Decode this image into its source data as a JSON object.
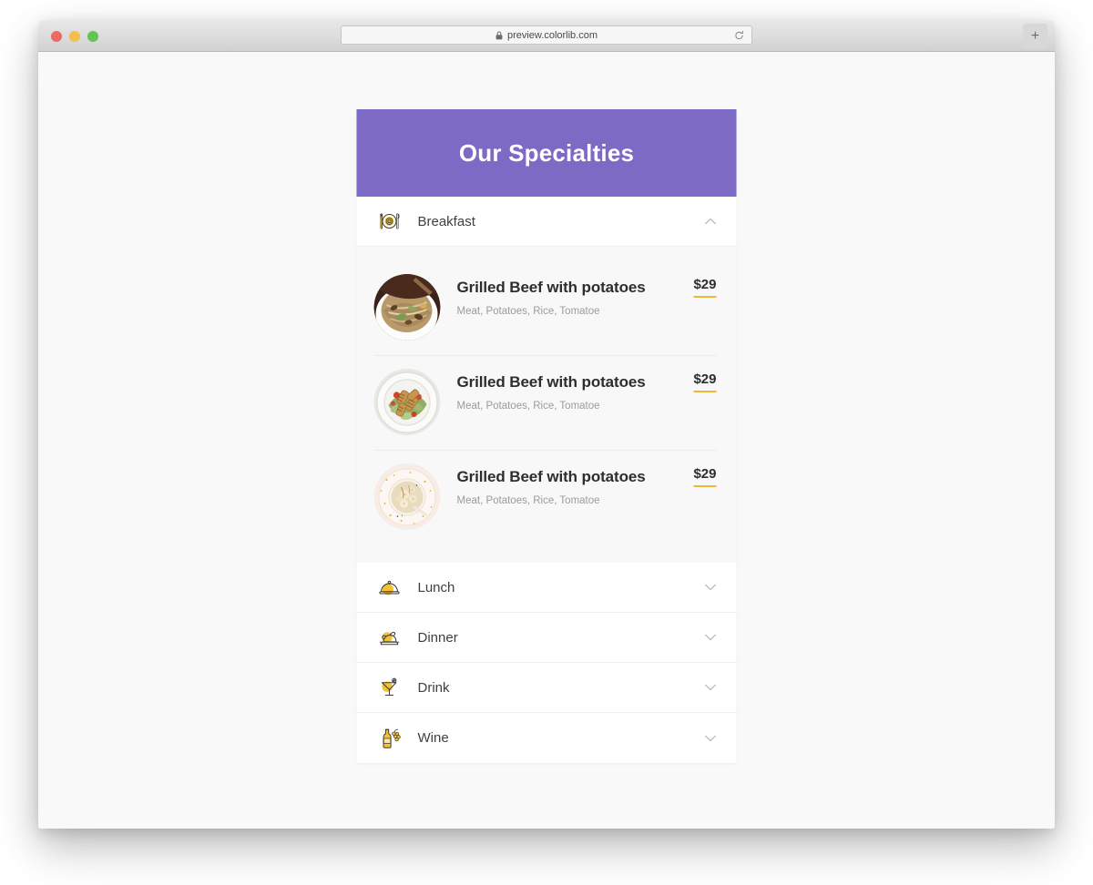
{
  "browser": {
    "url": "preview.colorlib.com",
    "lock_icon": "lock-icon",
    "reload_icon": "reload-icon",
    "new_tab_label": "+",
    "traffic_lights": [
      "close",
      "minimize",
      "maximize"
    ]
  },
  "menu": {
    "header_title": "Our Specialties",
    "header_color": "#7d6ac4",
    "accent_color": "#f2b731",
    "sections": [
      {
        "label": "Breakfast",
        "icon": "plate-cutlery-icon",
        "expanded": true,
        "chevron": "chevron-up-icon",
        "items": [
          {
            "title": "Grilled Beef with potatoes",
            "description": "Meat, Potatoes, Rice, Tomatoe",
            "price": "$29",
            "image": "noodle-stirfry-photo"
          },
          {
            "title": "Grilled Beef with potatoes",
            "description": "Meat, Potatoes, Rice, Tomatoe",
            "price": "$29",
            "image": "grilled-chicken-salad-photo"
          },
          {
            "title": "Grilled Beef with potatoes",
            "description": "Meat, Potatoes, Rice, Tomatoe",
            "price": "$29",
            "image": "oatmeal-banana-bowl-photo"
          }
        ]
      },
      {
        "label": "Lunch",
        "icon": "cloche-dome-icon",
        "expanded": false,
        "chevron": "chevron-down-icon",
        "items": []
      },
      {
        "label": "Dinner",
        "icon": "roast-turkey-icon",
        "expanded": false,
        "chevron": "chevron-down-icon",
        "items": []
      },
      {
        "label": "Drink",
        "icon": "cocktail-glass-icon",
        "expanded": false,
        "chevron": "chevron-down-icon",
        "items": []
      },
      {
        "label": "Wine",
        "icon": "wine-bottle-grapes-icon",
        "expanded": false,
        "chevron": "chevron-down-icon",
        "items": []
      }
    ]
  }
}
